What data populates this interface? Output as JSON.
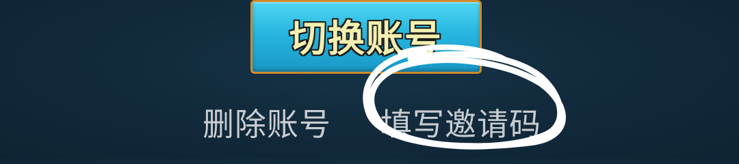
{
  "dialog": {
    "switch_account_button": "切换账号",
    "delete_account_link": "删除账号",
    "enter_invite_code_link": "填写邀请码"
  },
  "annotation": {
    "icon": "hand-drawn-circle-annotation",
    "color": "#ffffff"
  }
}
